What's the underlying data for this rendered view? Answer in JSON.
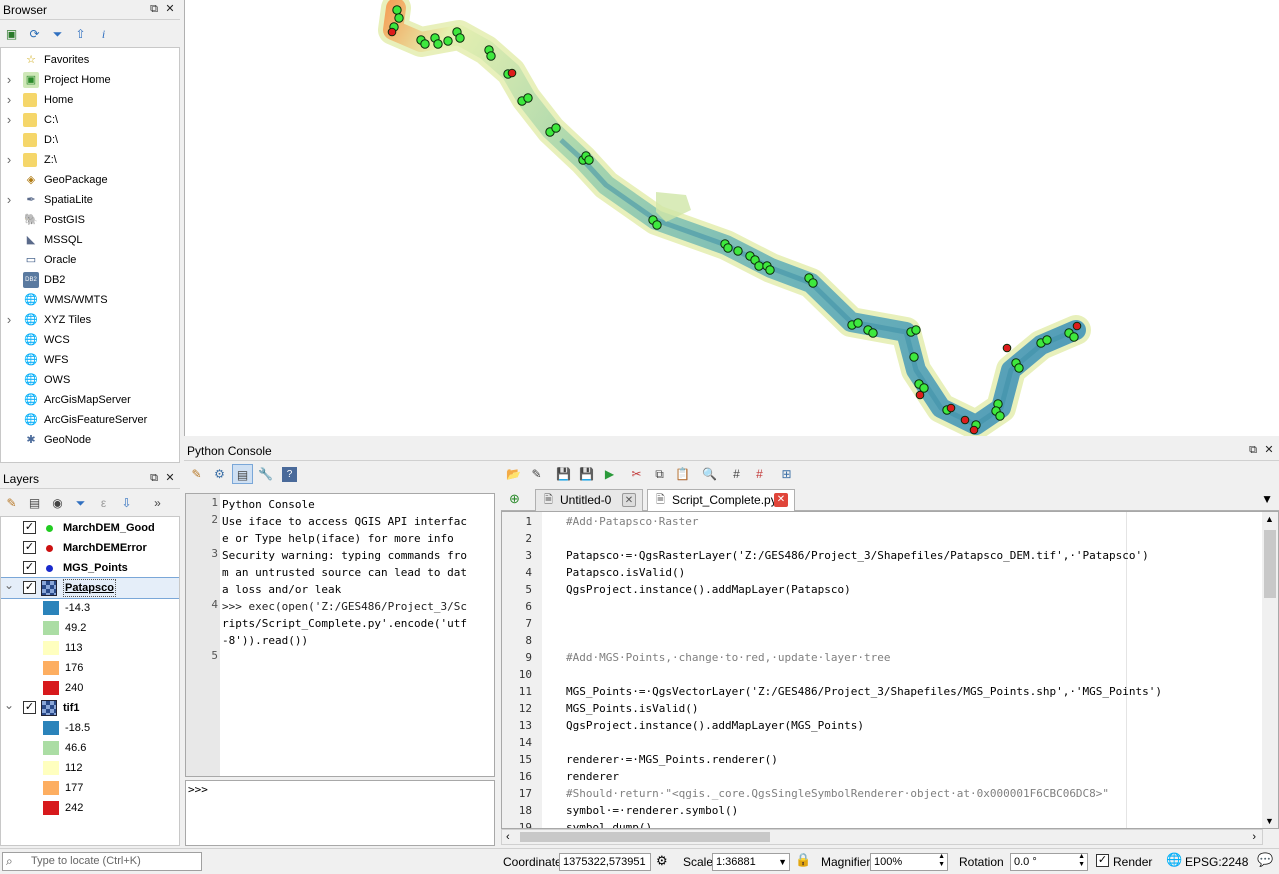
{
  "browser": {
    "title": "Browser",
    "items": [
      {
        "label": "Favorites",
        "icon": "star-icon",
        "expandable": false
      },
      {
        "label": "Project Home",
        "icon": "project-home-icon",
        "expandable": true
      },
      {
        "label": "Home",
        "icon": "folder-icon",
        "expandable": true
      },
      {
        "label": "C:\\",
        "icon": "folder-icon",
        "expandable": true
      },
      {
        "label": "D:\\",
        "icon": "folder-icon",
        "expandable": false
      },
      {
        "label": "Z:\\",
        "icon": "folder-icon",
        "expandable": true
      },
      {
        "label": "GeoPackage",
        "icon": "geopackage-icon",
        "expandable": false
      },
      {
        "label": "SpatiaLite",
        "icon": "spatialite-icon",
        "expandable": true
      },
      {
        "label": "PostGIS",
        "icon": "postgis-icon",
        "expandable": false
      },
      {
        "label": "MSSQL",
        "icon": "mssql-icon",
        "expandable": false
      },
      {
        "label": "Oracle",
        "icon": "oracle-icon",
        "expandable": false
      },
      {
        "label": "DB2",
        "icon": "db2-icon",
        "expandable": false
      },
      {
        "label": "WMS/WMTS",
        "icon": "globe-icon",
        "expandable": false
      },
      {
        "label": "XYZ Tiles",
        "icon": "globe-icon",
        "expandable": true
      },
      {
        "label": "WCS",
        "icon": "globe-icon",
        "expandable": false
      },
      {
        "label": "WFS",
        "icon": "globe-icon",
        "expandable": false
      },
      {
        "label": "OWS",
        "icon": "globe-icon",
        "expandable": false
      },
      {
        "label": "ArcGisMapServer",
        "icon": "globe-icon",
        "expandable": false
      },
      {
        "label": "ArcGisFeatureServer",
        "icon": "globe-icon",
        "expandable": false
      },
      {
        "label": "GeoNode",
        "icon": "geonode-icon",
        "expandable": false
      }
    ],
    "db2_text": "DB2"
  },
  "layers": {
    "title": "Layers",
    "items": [
      {
        "label": "MarchDEM_Good",
        "kind": "point",
        "color": "#22cc22"
      },
      {
        "label": "MarchDEMError",
        "kind": "point",
        "color": "#cc1111"
      },
      {
        "label": "MGS_Points",
        "kind": "point",
        "color": "#1a2acc"
      },
      {
        "label": "Patapsco",
        "kind": "raster",
        "selected": true
      },
      {
        "label": "-14.3",
        "kind": "legend",
        "color": "#2b83ba"
      },
      {
        "label": "49.2",
        "kind": "legend",
        "color": "#abdda4"
      },
      {
        "label": "113",
        "kind": "legend",
        "color": "#ffffbf"
      },
      {
        "label": "176",
        "kind": "legend",
        "color": "#fdae61"
      },
      {
        "label": "240",
        "kind": "legend",
        "color": "#d7191c"
      },
      {
        "label": "tif1",
        "kind": "raster"
      },
      {
        "label": "-18.5",
        "kind": "legend",
        "color": "#2b83ba"
      },
      {
        "label": "46.6",
        "kind": "legend",
        "color": "#abdda4"
      },
      {
        "label": "112",
        "kind": "legend",
        "color": "#ffffbf"
      },
      {
        "label": "177",
        "kind": "legend",
        "color": "#fdae61"
      },
      {
        "label": "242",
        "kind": "legend",
        "color": "#d7191c"
      }
    ]
  },
  "console": {
    "title": "Python Console",
    "output_lines": [
      {
        "n": "1",
        "text": "Python Console"
      },
      {
        "n": "2",
        "text": "Use iface to access QGIS API interfac"
      },
      {
        "n": "",
        "text": "e or Type help(iface) for more info"
      },
      {
        "n": "3",
        "text": "Security warning: typing commands fro"
      },
      {
        "n": "",
        "text": "m an untrusted source can lead to dat"
      },
      {
        "n": "",
        "text": "a loss and/or leak"
      },
      {
        "n": "4",
        "text": ">>> exec(open('Z:/GES486/Project_3/Sc"
      },
      {
        "n": "",
        "text": "ripts/Script_Complete.py'.encode('utf"
      },
      {
        "n": "",
        "text": "-8')).read())"
      },
      {
        "n": "5",
        "text": ""
      }
    ],
    "prompt": ">>>"
  },
  "editor": {
    "tabs": [
      {
        "label": "Untitled-0",
        "active": false
      },
      {
        "label": "Script_Complete.py",
        "active": true
      }
    ],
    "lines": [
      {
        "n": "1",
        "text": "#Add·Patapsco·Raster",
        "type": "comment"
      },
      {
        "n": "2",
        "text": "",
        "type": "code"
      },
      {
        "n": "3",
        "text": "Patapsco·=·QgsRasterLayer('Z:/GES486/Project_3/Shapefiles/Patapsco_DEM.tif',·'Patapsco')",
        "type": "code"
      },
      {
        "n": "4",
        "text": "Patapsco.isValid()",
        "type": "code"
      },
      {
        "n": "5",
        "text": "QgsProject.instance().addMapLayer(Patapsco)",
        "type": "code"
      },
      {
        "n": "6",
        "text": "",
        "type": "code"
      },
      {
        "n": "7",
        "text": "",
        "type": "code"
      },
      {
        "n": "8",
        "text": "",
        "type": "code"
      },
      {
        "n": "9",
        "text": "#Add·MGS·Points,·change·to·red,·update·layer·tree",
        "type": "comment"
      },
      {
        "n": "10",
        "text": "",
        "type": "code"
      },
      {
        "n": "11",
        "text": "MGS_Points·=·QgsVectorLayer('Z:/GES486/Project_3/Shapefiles/MGS_Points.shp',·'MGS_Points')",
        "type": "code"
      },
      {
        "n": "12",
        "text": "MGS_Points.isValid()",
        "type": "code"
      },
      {
        "n": "13",
        "text": "QgsProject.instance().addMapLayer(MGS_Points)",
        "type": "code"
      },
      {
        "n": "14",
        "text": "",
        "type": "code"
      },
      {
        "n": "15",
        "text": "renderer·=·MGS_Points.renderer()",
        "type": "code"
      },
      {
        "n": "16",
        "text": "renderer",
        "type": "code"
      },
      {
        "n": "17",
        "text": "#Should·return·\"<qgis._core.QgsSingleSymbolRenderer·object·at·0x000001F6CBC06DC8>\"",
        "type": "comment"
      },
      {
        "n": "18",
        "text": "symbol·=·renderer.symbol()",
        "type": "code"
      },
      {
        "n": "19",
        "text": "symbol.dump()",
        "type": "code"
      }
    ]
  },
  "status": {
    "search_placeholder": "Type to locate (Ctrl+K)",
    "coordinate_label": "Coordinate",
    "coordinate_value": "1375322,573951",
    "scale_label": "Scale",
    "scale_value": "1:36881",
    "magnifier_label": "Magnifier",
    "magnifier_value": "100%",
    "rotation_label": "Rotation",
    "rotation_value": "0.0 °",
    "render_label": "Render",
    "render_checked": true,
    "crs": "EPSG:2248"
  }
}
